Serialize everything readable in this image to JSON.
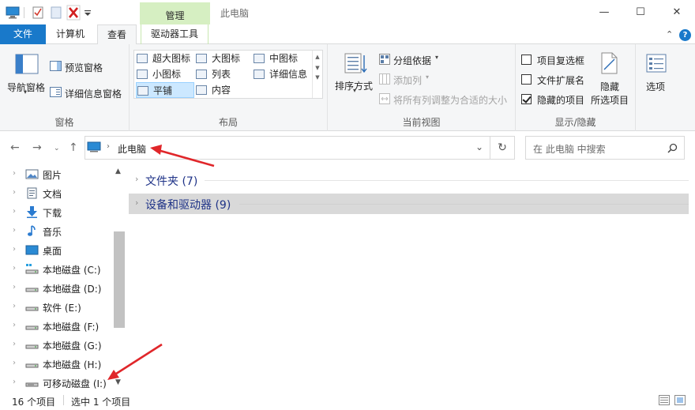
{
  "titlebar": {
    "manage_tab": "管理",
    "window_title": "此电脑",
    "min_symbol": "—",
    "max_symbol": "☐",
    "close_symbol": "✕"
  },
  "ribbon_tabs": {
    "file": "文件",
    "computer": "计算机",
    "view": "查看",
    "drive_tools": "驱动器工具"
  },
  "ribbon": {
    "panes": {
      "nav_pane": "导航窗格",
      "preview_pane": "预览窗格",
      "details_pane": "详细信息窗格",
      "label": "窗格"
    },
    "layout": {
      "items": [
        "超大图标",
        "大图标",
        "中图标",
        "小图标",
        "列表",
        "详细信息",
        "平铺",
        "内容"
      ],
      "selected": "平铺",
      "label": "布局"
    },
    "current_view": {
      "sort_by": "排序方式",
      "group_by": "分组依据",
      "add_columns": "添加列",
      "fit_columns": "将所有列调整为合适的大小",
      "label": "当前视图"
    },
    "show_hide": {
      "item_checkboxes": "项目复选框",
      "file_extensions": "文件扩展名",
      "hidden_items": "隐藏的项目",
      "hide_selected_line1": "隐藏",
      "hide_selected_line2": "所选项目",
      "label": "显示/隐藏",
      "checks": {
        "item_checkboxes": false,
        "file_extensions": false,
        "hidden_items": true
      }
    },
    "options": "选项"
  },
  "address": {
    "path": "此电脑",
    "search_placeholder": "在 此电脑 中搜索"
  },
  "nav_pane": {
    "items": [
      {
        "label": "图片",
        "icon": "pictures-icon"
      },
      {
        "label": "文档",
        "icon": "documents-icon"
      },
      {
        "label": "下载",
        "icon": "downloads-icon"
      },
      {
        "label": "音乐",
        "icon": "music-icon"
      },
      {
        "label": "桌面",
        "icon": "desktop-icon"
      },
      {
        "label": "本地磁盘 (C:)",
        "icon": "system-drive-icon"
      },
      {
        "label": "本地磁盘 (D:)",
        "icon": "drive-icon"
      },
      {
        "label": "软件 (E:)",
        "icon": "drive-icon"
      },
      {
        "label": "本地磁盘 (F:)",
        "icon": "drive-icon"
      },
      {
        "label": "本地磁盘 (G:)",
        "icon": "drive-icon"
      },
      {
        "label": "本地磁盘 (H:)",
        "icon": "drive-icon"
      },
      {
        "label": "可移动磁盘 (I:)",
        "icon": "removable-drive-icon"
      }
    ]
  },
  "content": {
    "groups": [
      {
        "title": "文件夹 (7)"
      },
      {
        "title": "设备和驱动器 (9)"
      }
    ]
  },
  "status": {
    "item_count": "16 个项目",
    "selected": "选中 1 个项目"
  },
  "colors": {
    "accent": "#1979ca",
    "manage_tab": "#d6efc2",
    "annotation_arrow": "#e0262a"
  }
}
